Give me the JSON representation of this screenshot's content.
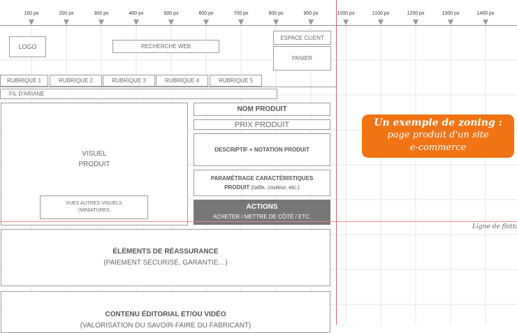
{
  "ruler": {
    "ticks": [
      "100 px",
      "200 px",
      "300 px",
      "400 px",
      "500 px",
      "600 px",
      "700 px",
      "800 px",
      "900 px",
      "1000 px",
      "1100 px",
      "1200 px",
      "1300 px",
      "1400 px"
    ]
  },
  "header": {
    "logo": "LOGO",
    "search": "RECHERCHE WEB",
    "client_space": "ESPACE CLIENT",
    "cart": "PANIER"
  },
  "nav": {
    "rubriques": [
      "RUBRIQUE 1",
      "RUBRIQUE 2",
      "RUBRIQUE 3",
      "RUBRIQUE 4",
      "RUBRIQUE 5"
    ],
    "breadcrumb": "FIL D'ARIANE"
  },
  "product": {
    "visual_line1": "VISUEL",
    "visual_line2": "PRODUIT",
    "thumbs_line1": "VUES AUTRES VISUELS",
    "thumbs_line2": "(MINIATURES",
    "name": "NOM PRODUIT",
    "price": "PRIX PRODUIT",
    "description": "DESCRIPTIF + NOTATION PRODUIT",
    "params_line1": "PARAMÉTRAGE CARACTÉRISTIQUES",
    "params_line2_bold": "PRODUIT",
    "params_line2_rest": " (taille, couleur, etc.)",
    "actions_title": "ACTIONS",
    "actions_sub": "ACHETER / METTRE DE CÔTÉ / ETC."
  },
  "reassurance": {
    "title": "ÉLÉMENTS DE RÉASSURANCE",
    "sub": "(PAIEMENT SÉCURISÉ, GARANTIE…)"
  },
  "editorial": {
    "title": "CONTENU ÉDITORIAL ET/OU VIDÉO",
    "sub": "(VALORISATION DU SAVOIR-FAIRE DU FABRICANT)"
  },
  "callout": {
    "line1": "Un exemple de zoning :",
    "line2": "page produit d'un site",
    "line3": "e-commerce"
  },
  "fold_label": "Ligne de flottaison",
  "colors": {
    "accent": "#f07314",
    "guide": "#e06060",
    "actions_bg": "#777777"
  }
}
